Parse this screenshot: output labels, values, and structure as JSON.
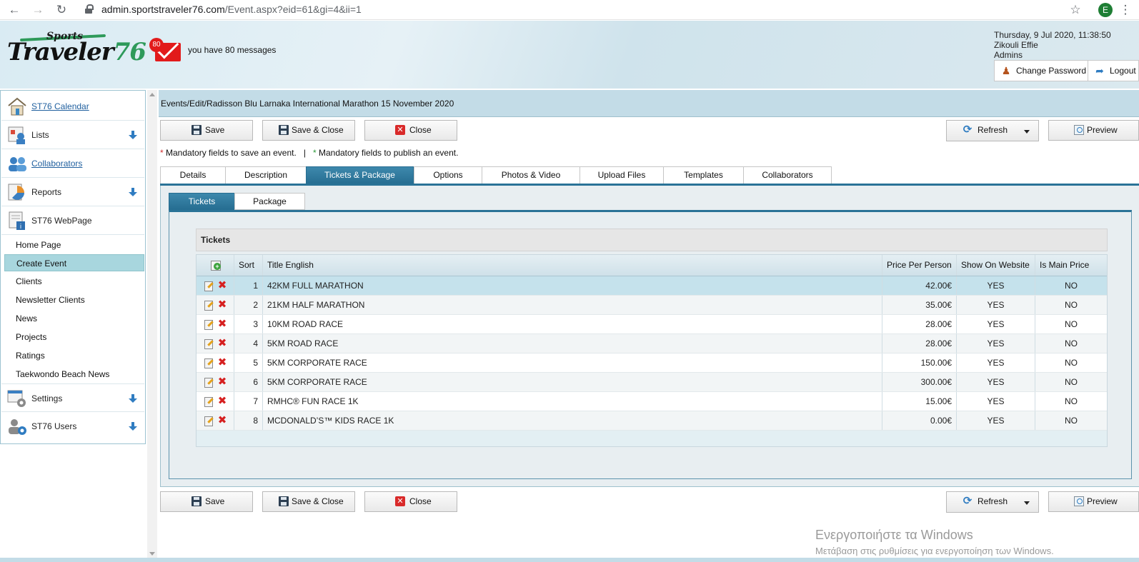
{
  "browser": {
    "url_host": "admin.sportstraveler76.com",
    "url_path": "/Event.aspx?eid=61&gi=4&ii=1",
    "profile_initial": "E"
  },
  "header": {
    "logo_top": "Sports",
    "logo_main": "Traveler",
    "logo_num": "76",
    "messages_count": "80",
    "messages_text": "you have 80 messages",
    "datetime": "Thursday, 9 Jul 2020, 11:38:50",
    "user": "Zikouli Effie",
    "role": "Admins",
    "change_password": "Change Password",
    "logout": "Logout"
  },
  "sidebar": {
    "sections": [
      {
        "label": "ST76 Calendar"
      },
      {
        "label": "Lists"
      },
      {
        "label": "Collaborators"
      },
      {
        "label": "Reports"
      },
      {
        "label": "ST76 WebPage"
      },
      {
        "label": "Settings"
      },
      {
        "label": "ST76 Users"
      }
    ],
    "items": [
      {
        "label": "Home Page"
      },
      {
        "label": "Create Event"
      },
      {
        "label": "Clients"
      },
      {
        "label": "Newsletter Clients"
      },
      {
        "label": "News"
      },
      {
        "label": "Projects"
      },
      {
        "label": "Ratings"
      },
      {
        "label": "Taekwondo Beach News"
      }
    ]
  },
  "breadcrumb": "Events/Edit/Radisson Blu Larnaka International Marathon 15 November 2020",
  "toolbar": {
    "save": "Save",
    "save_close": "Save & Close",
    "close": "Close",
    "refresh": "Refresh",
    "preview": "Preview"
  },
  "mandatory": {
    "star": "*",
    "save_text": "Mandatory fields to save an event.",
    "separator": "|",
    "publish_text": "Mandatory fields to publish an event."
  },
  "tabs": [
    "Details",
    "Description",
    "Tickets & Package",
    "Options",
    "Photos & Video",
    "Upload Files",
    "Templates",
    "Collaborators"
  ],
  "subtabs": [
    "Tickets",
    "Package"
  ],
  "grid": {
    "title": "Tickets",
    "columns": {
      "sort": "Sort",
      "title": "Title English",
      "price": "Price Per Person",
      "show": "Show On Website",
      "main": "Is Main Price"
    },
    "rows": [
      {
        "sort": "1",
        "title": "42KM FULL MARATHON",
        "price": "42.00€",
        "show": "YES",
        "main": "NO"
      },
      {
        "sort": "2",
        "title": "21KM HALF MARATHON",
        "price": "35.00€",
        "show": "YES",
        "main": "NO"
      },
      {
        "sort": "3",
        "title": "10KM ROAD RACE",
        "price": "28.00€",
        "show": "YES",
        "main": "NO"
      },
      {
        "sort": "4",
        "title": "5KM ROAD RACE",
        "price": "28.00€",
        "show": "YES",
        "main": "NO"
      },
      {
        "sort": "5",
        "title": "5KM CORPORATE RACE",
        "price": "150.00€",
        "show": "YES",
        "main": "NO"
      },
      {
        "sort": "6",
        "title": "5KM CORPORATE RACE",
        "price": "300.00€",
        "show": "YES",
        "main": "NO"
      },
      {
        "sort": "7",
        "title": "RMHC® FUN RACE 1K",
        "price": "15.00€",
        "show": "YES",
        "main": "NO"
      },
      {
        "sort": "8",
        "title": "MCDONALD’S™ KIDS RACE 1K",
        "price": "0.00€",
        "show": "YES",
        "main": "NO"
      }
    ]
  },
  "watermark": {
    "line1": "Ενεργοποιήστε τα Windows",
    "line2": "Μετάβαση στις ρυθμίσεις για ενεργοποίηση των Windows."
  }
}
